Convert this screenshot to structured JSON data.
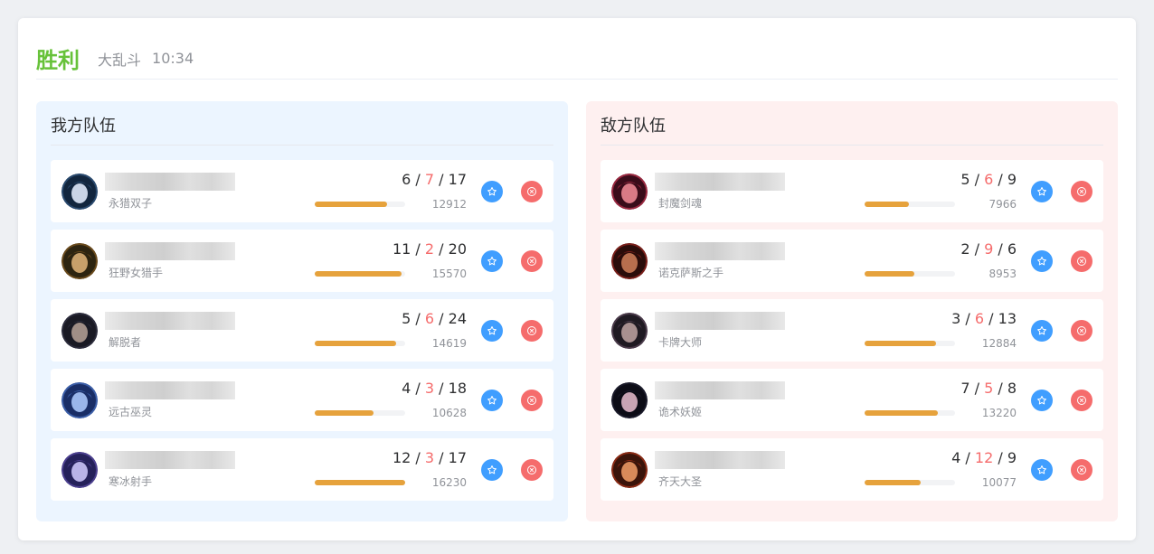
{
  "header": {
    "result": "胜利",
    "mode": "大乱斗",
    "duration": "10:34"
  },
  "teams": [
    {
      "title": "我方队伍",
      "players": [
        {
          "champion": "永猎双子",
          "kills": "6",
          "deaths": "7",
          "assists": "17",
          "damage": "12912",
          "damage_fraction": 0.8,
          "avatar": "kindred-portrait",
          "ring": "#2a4a6f",
          "bg": "#12263e",
          "face": "#c9d4e6"
        },
        {
          "champion": "狂野女猎手",
          "kills": "11",
          "deaths": "2",
          "assists": "20",
          "damage": "15570",
          "damage_fraction": 0.96,
          "avatar": "nidalee-portrait",
          "ring": "#6a4a1c",
          "bg": "#2d2410",
          "face": "#c8a06a"
        },
        {
          "champion": "解脱者",
          "kills": "5",
          "deaths": "6",
          "assists": "24",
          "damage": "14619",
          "damage_fraction": 0.9,
          "avatar": "sylas-portrait",
          "ring": "#2c2c3c",
          "bg": "#1a1a24",
          "face": "#a08e86"
        },
        {
          "champion": "远古巫灵",
          "kills": "4",
          "deaths": "3",
          "assists": "18",
          "damage": "10628",
          "damage_fraction": 0.65,
          "avatar": "xerath-portrait",
          "ring": "#3b5ea8",
          "bg": "#1a2e66",
          "face": "#9ab6ea"
        },
        {
          "champion": "寒冰射手",
          "kills": "12",
          "deaths": "3",
          "assists": "17",
          "damage": "16230",
          "damage_fraction": 1.0,
          "avatar": "ashe-portrait",
          "ring": "#4b3f8f",
          "bg": "#25215a",
          "face": "#b9b3e8"
        }
      ]
    },
    {
      "title": "敌方队伍",
      "players": [
        {
          "champion": "封魔剑魂",
          "kills": "5",
          "deaths": "6",
          "assists": "9",
          "damage": "7966",
          "damage_fraction": 0.49,
          "avatar": "yone-portrait",
          "ring": "#9a2840",
          "bg": "#3a0c1a",
          "face": "#d97a86"
        },
        {
          "champion": "诺克萨斯之手",
          "kills": "2",
          "deaths": "9",
          "assists": "6",
          "damage": "8953",
          "damage_fraction": 0.55,
          "avatar": "darius-portrait",
          "ring": "#7a1f1a",
          "bg": "#2a0c0a",
          "face": "#b86e4e"
        },
        {
          "champion": "卡牌大师",
          "kills": "3",
          "deaths": "6",
          "assists": "13",
          "damage": "12884",
          "damage_fraction": 0.79,
          "avatar": "twisted-fate-portrait",
          "ring": "#4a3a4a",
          "bg": "#1f1a22",
          "face": "#a89090"
        },
        {
          "champion": "诡术妖姬",
          "kills": "7",
          "deaths": "5",
          "assists": "8",
          "damage": "13220",
          "damage_fraction": 0.81,
          "avatar": "leblanc-portrait",
          "ring": "#1a1a2a",
          "bg": "#0c0c16",
          "face": "#c8a4b4"
        },
        {
          "champion": "齐天大圣",
          "kills": "4",
          "deaths": "12",
          "assists": "9",
          "damage": "10077",
          "damage_fraction": 0.62,
          "avatar": "wukong-portrait",
          "ring": "#8a2a14",
          "bg": "#3a140a",
          "face": "#d88a5a"
        }
      ]
    }
  ],
  "icons": {
    "favorite": "star-icon",
    "report": "close-circle-icon"
  },
  "colors": {
    "win": "#67c23a",
    "deaths": "#f56c6c",
    "damage_bar": "#e6a23c",
    "favorite_button": "#409eff",
    "report_button": "#f56c6c",
    "our_team_bg": "#ecf5ff",
    "enemy_team_bg": "#fef0f0"
  }
}
